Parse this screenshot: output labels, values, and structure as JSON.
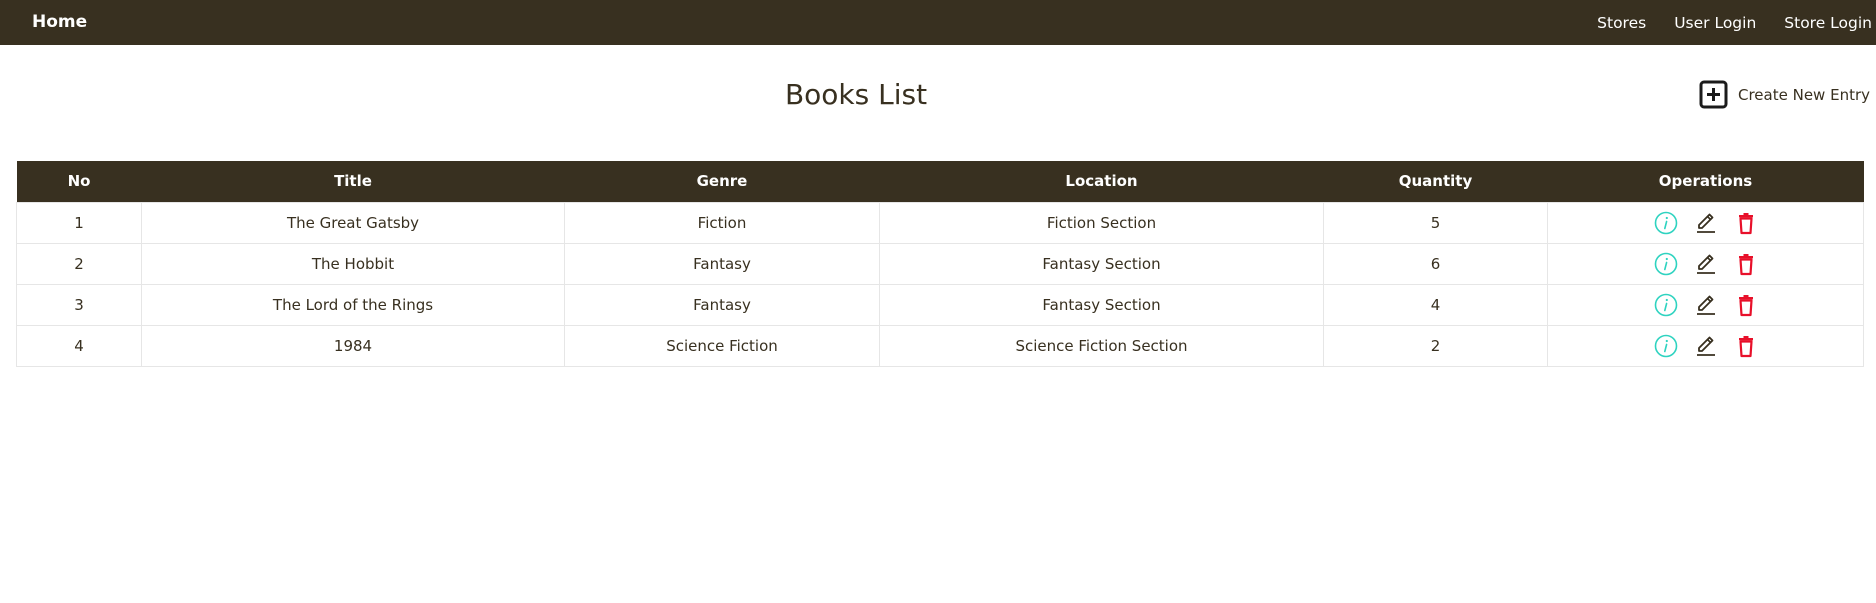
{
  "nav": {
    "brand": "Home",
    "links": [
      "Stores",
      "User Login",
      "Store Login"
    ]
  },
  "page": {
    "title": "Books List",
    "create_label": "Create New Entry"
  },
  "table": {
    "columns": [
      "No",
      "Title",
      "Genre",
      "Location",
      "Quantity",
      "Operations"
    ],
    "rows": [
      {
        "no": "1",
        "title": "The Great Gatsby",
        "genre": "Fiction",
        "location": "Fiction Section",
        "quantity": "5"
      },
      {
        "no": "2",
        "title": "The Hobbit",
        "genre": "Fantasy",
        "location": "Fantasy Section",
        "quantity": "6"
      },
      {
        "no": "3",
        "title": "The Lord of the Rings",
        "genre": "Fantasy",
        "location": "Fantasy Section",
        "quantity": "4"
      },
      {
        "no": "4",
        "title": "1984",
        "genre": "Science Fiction",
        "location": "Science Fiction Section",
        "quantity": "2"
      }
    ],
    "operation_icons": [
      "info-icon",
      "edit-icon",
      "delete-icon"
    ]
  },
  "colors": {
    "header_bg": "#383020",
    "info": "#2ed3c0",
    "edit": "#383020",
    "delete": "#e8102a"
  }
}
